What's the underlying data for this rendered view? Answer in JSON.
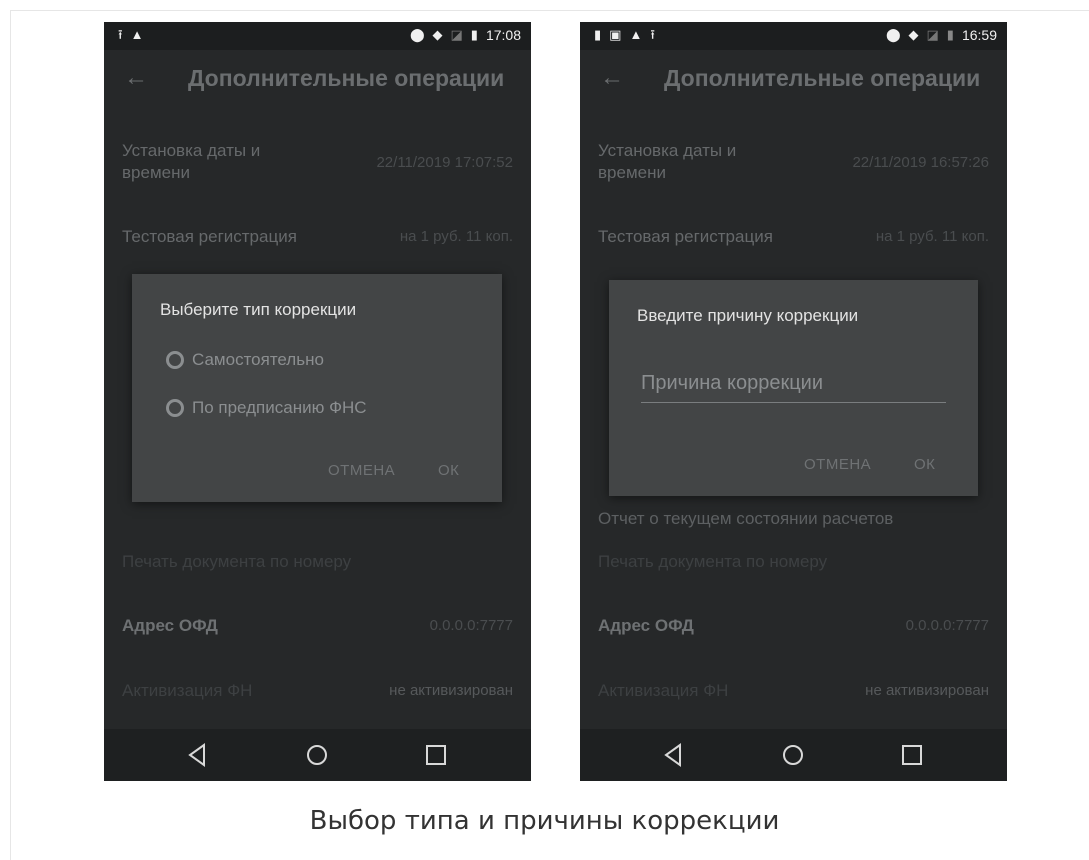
{
  "left_screen": {
    "status_bar": {
      "time": "17:08",
      "left_icons": [
        "upload-icon",
        "android-icon"
      ],
      "right_icons": [
        "location-icon",
        "wifi-icon",
        "no-sim-icon",
        "battery-charging-icon"
      ]
    },
    "app_bar": {
      "title": "Дополнительные операции"
    },
    "list": {
      "date_label": "Установка даты и\nвремени",
      "date_value": "22/11/2019 17:07:52",
      "test_label": "Тестовая регистрация",
      "test_value": "на 1 руб. 11 коп.",
      "print_label": "Печать документа по номеру",
      "ofd_label": "Адрес ОФД",
      "ofd_value": "0.0.0.0:7777",
      "fn_label": "Активизация ФН",
      "fn_value": "не активизирован"
    },
    "dialog": {
      "title": "Выберите тип коррекции",
      "options": [
        "Самостоятельно",
        "По предписанию ФНС"
      ],
      "cancel": "ОТМЕНА",
      "ok": "ОК"
    }
  },
  "right_screen": {
    "status_bar": {
      "time": "16:59",
      "left_icons": [
        "sim-icon",
        "image-icon",
        "android-icon",
        "upload-icon"
      ],
      "right_icons": [
        "location-icon",
        "wifi-icon",
        "no-sim-icon",
        "battery-icon"
      ]
    },
    "app_bar": {
      "title": "Дополнительные операции"
    },
    "list": {
      "date_label": "Установка даты и\nвремени",
      "date_value": "22/11/2019 16:57:26",
      "test_label": "Тестовая регистрация",
      "test_value": "на 1 руб. 11 коп.",
      "report_label": "Отчет о текущем состоянии расчетов",
      "print_label": "Печать документа по номеру",
      "ofd_label": "Адрес ОФД",
      "ofd_value": "0.0.0.0:7777",
      "fn_label": "Активизация ФН",
      "fn_value": "не активизирован"
    },
    "dialog": {
      "title": "Введите причину коррекции",
      "input_placeholder": "Причина коррекции",
      "cancel": "ОТМЕНА",
      "ok": "ОК"
    }
  },
  "caption": "Выбор типа и причины коррекции"
}
